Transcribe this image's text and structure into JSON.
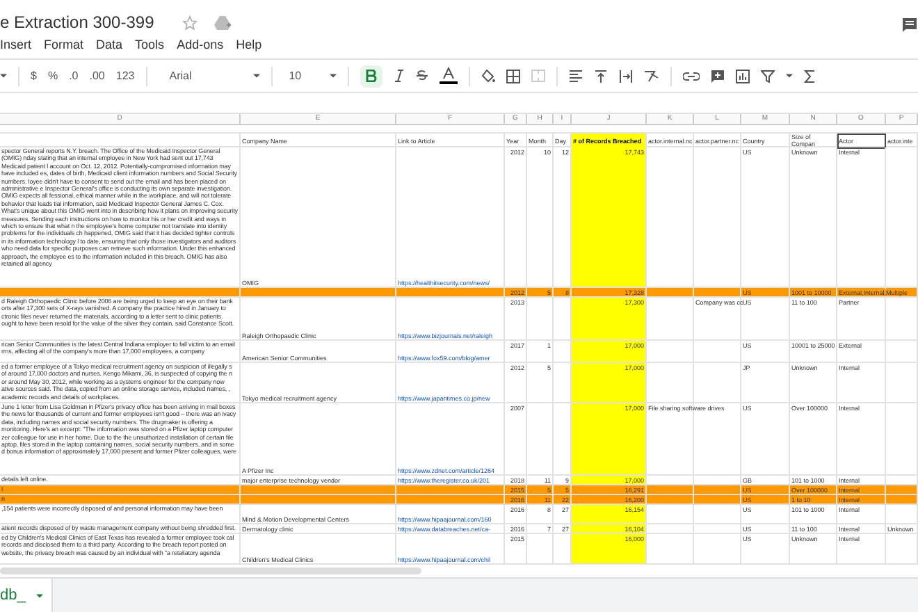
{
  "title": "e Extraction 300-399",
  "menu": [
    "Insert",
    "Format",
    "Data",
    "Tools",
    "Add-ons",
    "Help"
  ],
  "toolbar": {
    "currency": "$",
    "percent": "%",
    "decrease_decimals": ".0",
    "increase_decimals": ".00",
    "more_formats": "123",
    "font": "Arial",
    "font_size": "10",
    "bold_on": true
  },
  "column_letters": [
    "D",
    "E",
    "F",
    "G",
    "H",
    "I",
    "J",
    "K",
    "L",
    "M",
    "N",
    "O",
    "P"
  ],
  "columns": [
    {
      "highlighted": false,
      "selected": false
    },
    {
      "header": "Company Name",
      "highlighted": false,
      "selected": false
    },
    {
      "header": "Link to Article",
      "highlighted": false,
      "selected": false
    },
    {
      "header": "Year",
      "highlighted": false,
      "selected": false
    },
    {
      "header": "Month",
      "highlighted": false,
      "selected": false
    },
    {
      "header": "Day",
      "highlighted": false,
      "selected": false
    },
    {
      "header": "# of Records Breached",
      "highlighted": true,
      "selected": false
    },
    {
      "header": "actor.internal.nc",
      "highlighted": false,
      "selected": false
    },
    {
      "header": "actor.partner.nc",
      "highlighted": false,
      "selected": false
    },
    {
      "header": "Country",
      "highlighted": false,
      "selected": false
    },
    {
      "header": "Size of Compan",
      "highlighted": false,
      "selected": false
    },
    {
      "header": "Actor",
      "highlighted": false,
      "selected": true
    },
    {
      "header": "actor.inte",
      "highlighted": false,
      "selected": false
    }
  ],
  "rows": [
    {
      "highlighted": false,
      "description": "spector General reports N.Y. breach. The Office of the Medicaid Inspector General (OMIG) nday stating that an internal employee in New York had sent out 17,743 Medicaid patient l account on Oct. 12, 2012. Potentially-compromised information may have included es, dates of birth, Medicaid client information numbers and Social Security numbers. loyee didn't have to consent to send out the email and has been placed on administrative e Inspector General's office is conducting its own separate investigation. OMIG expects all fessional, ethical manner while in the workplace, and will not tolerate behavior that leads tial information, said Medicaid Inspector General James C. Cox. What's unique about this OMIG went into in describing how it plans on improving security measures. Sending each instructions on how to monitor his or her credit and ways in which to ensure that what n the employee's home computer not translate into identity problems for the individuals ch happened, OMIG said that it has decided tighter controls in its information technology l to date, ensuring that only those investigators and auditors who need data for specific purposes can retrieve such information. Under this enhanced approach, the employee es to the information included in this breach. OMIG has also retained all agency",
      "company": "OMIG",
      "link": "https://healthitsecurity.com/news/",
      "year": "2012",
      "month": "10",
      "day": "12",
      "records": "17,743",
      "country": "US",
      "size": "Unknown",
      "actor": "Internal"
    },
    {
      "highlighted": true,
      "year": "2012",
      "month": "5",
      "day": "8",
      "records": "17,328",
      "country": "US",
      "size": "1001 to 10000",
      "actor": "External,Internal,Multiple"
    },
    {
      "highlighted": false,
      "description": "d Raleigh Orthopaedic Clinic before 2006 are being urged to keep an eye on their bank orts after 17,300 sets of X-rays vanished. A company the practice hired in January to ctronic files never returned the materials, according to a letter sent to clinic patients. ought to have been resold for the value of the silver they contain, said Constance Scott.",
      "company": "Raleigh Orthopaedic Clinic",
      "link": "https://www.bizjournals.net/raleigh",
      "year": "2013",
      "records": "17,300",
      "partner": "Company was cc",
      "country": "US",
      "size": "11 to 100",
      "actor": "Partner"
    },
    {
      "highlighted": false,
      "description": "rican Senior Communities is the latest Central Indiana employer to fall victim to an email rms, affecting all of the company's more than 17,000 employees, a company",
      "company": "American Senior Communities",
      "link": "https://www.fox59.com/blog/amer",
      "year": "2017",
      "month": "1",
      "records": "17,000",
      "country": "US",
      "size": "10001 to 25000",
      "actor": "External"
    },
    {
      "highlighted": false,
      "description": "ed a former employee of a Tokyo medical recruitment agency on suspicion of illegally s of around 17,000 doctors and nurses. Kengo Mikami, 36, is suspected of copying the n or around May 30, 2012, while working as a systems engineer for the company now ative sources said. The data, copied from an online storage service, included names, , academic records and details of workplaces.",
      "company": "Tokyo medical recruitment agency",
      "link": "https://www.japantimes.co.jp/new",
      "year": "2012",
      "month": "5",
      "records": "17,000",
      "country": "JP",
      "size": "Unknown",
      "actor": "Internal"
    },
    {
      "highlighted": false,
      "description": "June 1 letter from Lisa Goldman in Pfizer's privacy office has been arriving in mail boxes the news for thousands of current and former employees isn't good – there was an ivacy data, including names and social security numbers. The drugmaker is offering a monitoring. Here's an excerpt: \"The information was stored on a Pfizer laptop computer zer colleague for use in her home. Due to the the unauthorized installation of certain file aptop, files stored in the laptop containing names, social security numbers, and in some d bonus information of approximately 17,000 present and former Pfizer colleagues, were",
      "company": "A Pfizer Inc",
      "link": "https://www.zdnet.com/article/1264",
      "year": "2007",
      "records": "17,000",
      "internal": "File sharing software drives",
      "country": "US",
      "size": "Over 100000",
      "actor": "Internal"
    },
    {
      "highlighted": false,
      "description": "details left online.",
      "company": "major enterprise technology vendor",
      "link": "https://www.theregister.co.uk/201",
      "year": "2018",
      "month": "11",
      "day": "9",
      "records": "17,000",
      "country": "GB",
      "size": "101 to 1000",
      "actor": "Internal"
    },
    {
      "highlighted": true,
      "description": "t",
      "year": "2015",
      "month": "5",
      "day": "5",
      "records": "16,291",
      "country": "US",
      "size": "Over 100000",
      "actor": "Internal"
    },
    {
      "highlighted": true,
      "description": "n",
      "year": "2016",
      "month": "11",
      "day": "22",
      "records": "16,200",
      "country": "US",
      "size": "1 to 10",
      "actor": "Internal"
    },
    {
      "highlighted": false,
      "description": ",154 patients were incorrectly disposed of and personal information may have been",
      "company": "Mind & Motion Developmental Centers",
      "link": "https://www.hipaajournal.com/160",
      "year": "2016",
      "month": "8",
      "day": "27",
      "records": "16,154",
      "country": "US",
      "size": "101 to 1000",
      "actor": "Internal"
    },
    {
      "highlighted": false,
      "description": "atient records disposed of by waste management company without being shredded first.",
      "company": "Dermatology clinic",
      "link": "https://www.databreaches.net/ca-",
      "year": "2016",
      "month": "7",
      "day": "27",
      "records": "16,104",
      "country": "US",
      "size": "11 to 100",
      "actor": "Internal",
      "actor2": "Unknown"
    },
    {
      "highlighted": false,
      "description": "ed by Children's Medical Clinics of East Texas has revealed a former employee took cal records and disclosed them to a third party. According to the breach report posted on website, the privacy breach was caused by an individual with \"a retaliatory agenda",
      "company": "Children's Medical Clinics",
      "link": "https://www.hipaajournal.com/chil",
      "year": "2015",
      "records": "16,000",
      "country": "US",
      "size": "Unknown",
      "actor": "Internal"
    }
  ],
  "sheet_tab": "db_"
}
